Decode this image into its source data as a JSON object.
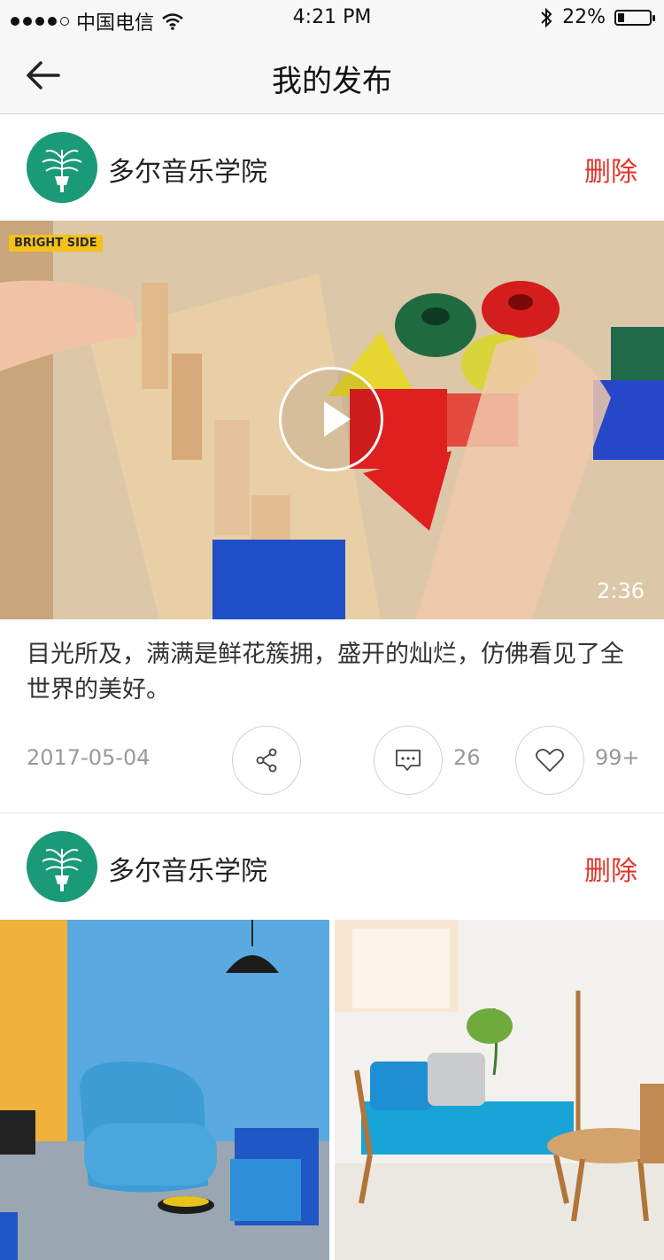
{
  "status_bar": {
    "carrier": "中国电信",
    "time": "4:21 PM",
    "battery_text": "22%",
    "battery_level": 0.22
  },
  "nav": {
    "title": "我的发布"
  },
  "posts": [
    {
      "author": "多尔音乐学院",
      "delete_label": "删除",
      "video_badge": "BRIGHT SIDE",
      "duration": "2:36",
      "caption": "目光所及，满满是鲜花簇拥，盛开的灿烂，仿佛看见了全世界的美好。",
      "date": "2017-05-04",
      "comment_count": "26",
      "like_count": "99+"
    },
    {
      "author": "多尔音乐学院",
      "delete_label": "删除"
    }
  ],
  "colors": {
    "accent_red": "#e4342a",
    "avatar_green": "#1a9a77",
    "meta_gray": "#999999"
  },
  "icons": [
    "signal-dots-icon",
    "wifi-icon",
    "bluetooth-icon",
    "battery-icon",
    "back-arrow-icon",
    "play-icon",
    "share-icon",
    "comment-icon",
    "heart-icon"
  ]
}
